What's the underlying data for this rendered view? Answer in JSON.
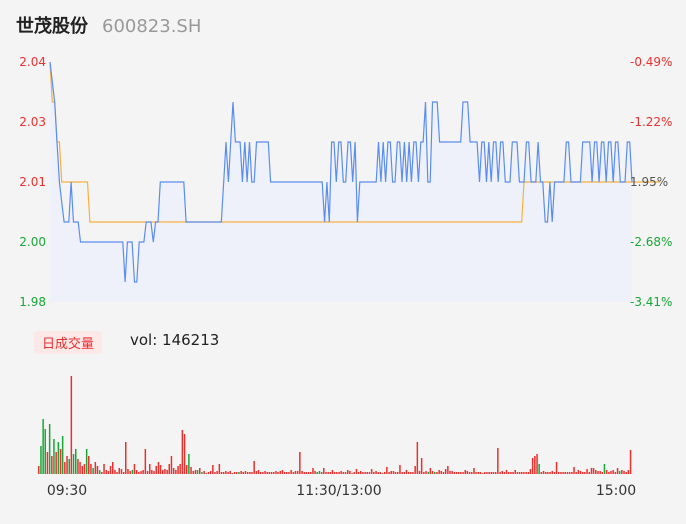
{
  "header": {
    "name": "世茂股份",
    "code": "600823.SH"
  },
  "volume_panel": {
    "badge": "日成交量",
    "vol_label": "vol: 146213"
  },
  "colors": {
    "price_line": "#5b8def",
    "avg_line": "#f5b041",
    "up": "#e8312f",
    "down": "#1aa638",
    "area_fill": "#eef1f9"
  },
  "chart_data": [
    {
      "type": "line",
      "y_left_ticks": [
        "2.04",
        "2.03",
        "2.01",
        "2.00",
        "1.98"
      ],
      "y_left_values": [
        2.04,
        2.03,
        2.01,
        2.0,
        1.98
      ],
      "y_right_ticks": [
        "-0.49%",
        "-1.22%",
        "1.95%",
        "-2.68%",
        "-3.41%"
      ],
      "ylim": [
        1.98,
        2.04
      ],
      "series": [
        {
          "key": "price",
          "values": [
            2.04,
            2.035,
            2.03,
            2.02,
            2.01,
            2.005,
            2.0,
            2.0,
            2.0,
            2.01,
            2.0,
            2.0,
            2.0,
            1.995,
            1.995,
            1.995,
            1.995,
            1.995,
            1.995,
            1.995,
            1.995,
            1.995,
            1.995,
            1.995,
            1.995,
            1.995,
            1.995,
            1.995,
            1.995,
            1.995,
            1.995,
            1.995,
            1.985,
            1.995,
            1.995,
            1.995,
            1.985,
            1.985,
            1.995,
            1.995,
            1.995,
            2.0,
            2.0,
            2.0,
            1.995,
            2.0,
            2.0,
            2.01,
            2.01,
            2.01,
            2.01,
            2.01,
            2.01,
            2.01,
            2.01,
            2.01,
            2.01,
            2.01,
            2.0,
            2.0,
            2.0,
            2.0,
            2.0,
            2.0,
            2.0,
            2.0,
            2.0,
            2.0,
            2.0,
            2.0,
            2.0,
            2.0,
            2.0,
            2.0,
            2.01,
            2.02,
            2.01,
            2.02,
            2.03,
            2.02,
            2.02,
            2.02,
            2.01,
            2.02,
            2.01,
            2.02,
            2.01,
            2.01,
            2.02,
            2.02,
            2.02,
            2.02,
            2.02,
            2.02,
            2.01,
            2.01,
            2.01,
            2.01,
            2.01,
            2.01,
            2.01,
            2.01,
            2.01,
            2.01,
            2.01,
            2.01,
            2.01,
            2.01,
            2.01,
            2.01,
            2.01,
            2.01,
            2.01,
            2.01,
            2.01,
            2.01,
            2.01,
            2.0,
            2.01,
            2.0,
            2.02,
            2.02,
            2.01,
            2.02,
            2.02,
            2.01,
            2.01,
            2.02,
            2.02,
            2.01,
            2.02,
            2.0,
            2.01,
            2.01,
            2.01,
            2.01,
            2.01,
            2.01,
            2.01,
            2.01,
            2.02,
            2.01,
            2.02,
            2.01,
            2.02,
            2.02,
            2.01,
            2.01,
            2.02,
            2.02,
            2.01,
            2.02,
            2.01,
            2.02,
            2.01,
            2.02,
            2.02,
            2.01,
            2.02,
            2.02,
            2.03,
            2.01,
            2.01,
            2.03,
            2.03,
            2.03,
            2.02,
            2.02,
            2.02,
            2.02,
            2.02,
            2.02,
            2.02,
            2.02,
            2.02,
            2.02,
            2.03,
            2.03,
            2.03,
            2.02,
            2.02,
            2.02,
            2.02,
            2.01,
            2.02,
            2.02,
            2.01,
            2.02,
            2.01,
            2.02,
            2.02,
            2.01,
            2.02,
            2.02,
            2.01,
            2.01,
            2.01,
            2.02,
            2.02,
            2.02,
            2.01,
            2.01,
            2.01,
            2.02,
            2.02,
            2.01,
            2.01,
            2.01,
            2.02,
            2.01,
            2.01,
            2.0,
            2.0,
            2.01,
            2.0,
            2.01,
            2.01,
            2.01,
            2.01,
            2.01,
            2.02,
            2.02,
            2.01,
            2.01,
            2.01,
            2.01,
            2.01,
            2.02,
            2.02,
            2.02,
            2.02,
            2.01,
            2.02,
            2.02,
            2.01,
            2.02,
            2.02,
            2.01,
            2.02,
            2.02,
            2.01,
            2.02,
            2.02,
            2.01,
            2.01,
            2.01,
            2.02,
            2.02,
            2.01
          ]
        },
        {
          "key": "average",
          "values": [
            2.04,
            2.03,
            2.03,
            2.02,
            2.02,
            2.01,
            2.01,
            2.01,
            2.01,
            2.01,
            2.01,
            2.01,
            2.01,
            2.01,
            2.01,
            2.01,
            2.01,
            2.0,
            2.0,
            2.0,
            2.0,
            2.0,
            2.0,
            2.0,
            2.0,
            2.0,
            2.0,
            2.0,
            2.0,
            2.0,
            2.0,
            2.0,
            2.0,
            2.0,
            2.0,
            2.0,
            2.0,
            2.0,
            2.0,
            2.0,
            2.0,
            2.0,
            2.0,
            2.0,
            2.0,
            2.0,
            2.0,
            2.0,
            2.0,
            2.0,
            2.0,
            2.0,
            2.0,
            2.0,
            2.0,
            2.0,
            2.0,
            2.0,
            2.0,
            2.0,
            2.0,
            2.0,
            2.0,
            2.0,
            2.0,
            2.0,
            2.0,
            2.0,
            2.0,
            2.0,
            2.0,
            2.0,
            2.0,
            2.0,
            2.0,
            2.0,
            2.0,
            2.0,
            2.0,
            2.0,
            2.0,
            2.0,
            2.0,
            2.0,
            2.0,
            2.0,
            2.0,
            2.0,
            2.0,
            2.0,
            2.0,
            2.0,
            2.0,
            2.0,
            2.0,
            2.0,
            2.0,
            2.0,
            2.0,
            2.0,
            2.0,
            2.0,
            2.0,
            2.0,
            2.0,
            2.0,
            2.0,
            2.0,
            2.0,
            2.0,
            2.0,
            2.0,
            2.0,
            2.0,
            2.0,
            2.0,
            2.0,
            2.0,
            2.0,
            2.0,
            2.0,
            2.0,
            2.0,
            2.0,
            2.0,
            2.0,
            2.0,
            2.0,
            2.0,
            2.0,
            2.0,
            2.0,
            2.0,
            2.0,
            2.0,
            2.0,
            2.0,
            2.0,
            2.0,
            2.0,
            2.0,
            2.0,
            2.0,
            2.0,
            2.0,
            2.0,
            2.0,
            2.0,
            2.0,
            2.0,
            2.0,
            2.0,
            2.0,
            2.0,
            2.0,
            2.0,
            2.0,
            2.0,
            2.0,
            2.0,
            2.0,
            2.0,
            2.0,
            2.0,
            2.0,
            2.0,
            2.0,
            2.0,
            2.0,
            2.0,
            2.0,
            2.0,
            2.0,
            2.0,
            2.0,
            2.0,
            2.0,
            2.0,
            2.0,
            2.0,
            2.0,
            2.0,
            2.0,
            2.0,
            2.0,
            2.0,
            2.0,
            2.0,
            2.0,
            2.0,
            2.0,
            2.0,
            2.0,
            2.0,
            2.0,
            2.0,
            2.0,
            2.0,
            2.0,
            2.0,
            2.0,
            2.0,
            2.01,
            2.01,
            2.01,
            2.01,
            2.01,
            2.01,
            2.01,
            2.01,
            2.01,
            2.01,
            2.01,
            2.01,
            2.01,
            2.01,
            2.01,
            2.01,
            2.01,
            2.01,
            2.01,
            2.01,
            2.01,
            2.01,
            2.01,
            2.01,
            2.01,
            2.01,
            2.01,
            2.01,
            2.01,
            2.01,
            2.01,
            2.01,
            2.01,
            2.01,
            2.01,
            2.01,
            2.01,
            2.01,
            2.01,
            2.01,
            2.01,
            2.01,
            2.01,
            2.01,
            2.01,
            2.01,
            2.01,
            2.01,
            2.01,
            2.01,
            2.01,
            2.01,
            2.01,
            2.01,
            2.01,
            2.01,
            2.01,
            2.01,
            2.01
          ]
        }
      ]
    },
    {
      "type": "bar",
      "x_ticks": [
        "09:30",
        "11:30/13:00",
        "15:00"
      ],
      "volumes": [
        8,
        28,
        55,
        45,
        22,
        50,
        18,
        35,
        22,
        32,
        25,
        38,
        12,
        18,
        15,
        98,
        20,
        25,
        15,
        12,
        8,
        10,
        25,
        18,
        10,
        6,
        12,
        8,
        4,
        2,
        10,
        4,
        3,
        8,
        12,
        4,
        2,
        6,
        5,
        2,
        32,
        5,
        3,
        4,
        10,
        4,
        2,
        3,
        4,
        25,
        3,
        10,
        4,
        3,
        8,
        12,
        9,
        4,
        5,
        4,
        10,
        18,
        6,
        4,
        8,
        10,
        44,
        40,
        9,
        20,
        7,
        3,
        4,
        4,
        6,
        2,
        3,
        1,
        2,
        3,
        9,
        2,
        3,
        10,
        2,
        2,
        3,
        2,
        3,
        1,
        2,
        2,
        2,
        3,
        2,
        3,
        2,
        2,
        2,
        13,
        3,
        4,
        2,
        2,
        3,
        2,
        2,
        2,
        2,
        3,
        2,
        3,
        4,
        2,
        2,
        2,
        4,
        2,
        3,
        3,
        22,
        3,
        2,
        2,
        2,
        2,
        6,
        3,
        2,
        3,
        2,
        6,
        2,
        2,
        2,
        4,
        2,
        2,
        2,
        3,
        2,
        2,
        4,
        3,
        1,
        2,
        5,
        2,
        3,
        2,
        2,
        2,
        2,
        5,
        2,
        3,
        2,
        2,
        1,
        2,
        7,
        2,
        3,
        3,
        2,
        2,
        9,
        2,
        2,
        4,
        2,
        2,
        2,
        8,
        32,
        3,
        16,
        2,
        3,
        2,
        6,
        3,
        2,
        2,
        4,
        3,
        2,
        5,
        8,
        3,
        3,
        2,
        2,
        2,
        2,
        2,
        4,
        3,
        2,
        2,
        6,
        2,
        2,
        2,
        1,
        2,
        2,
        2,
        2,
        2,
        2,
        26,
        2,
        3,
        2,
        4,
        2,
        2,
        2,
        4,
        2,
        2,
        2,
        2,
        2,
        2,
        5,
        16,
        18,
        20,
        10,
        2,
        3,
        2,
        2,
        2,
        3,
        2,
        12,
        2,
        2,
        2,
        2,
        2,
        2,
        2,
        7,
        2,
        4,
        3,
        2,
        2,
        5,
        2,
        6,
        6,
        4,
        3,
        3,
        2,
        10,
        4,
        2,
        3,
        4,
        2,
        6,
        3,
        4,
        3,
        2,
        4,
        24
      ],
      "directions": "rgggrgrgrgrgrrgrggrrrrgrrgrrgrrrrrrrrrrrrrrgrrrrrrrrrrrrrrrrrrrrrrrrrgrrrgrgrrrrrrrrrrrrrrrrgrrrrrrrrrrrrrrrrrrrrrrrrrrrrrrrrrrrggrrrrrrrrrrrrrrrrrrrrrrrrrrrrrrrrrrrrrrrrrrrrrrrrrgrrgrrrrrrrrrrrrrrrrrrrrrrrrrrrrrrrrrrrrrrrrrrrrrrrgrrrrrrrrrrrrrrrrrrrrrrrrrrrrrgrrrrrrgrrrrrrrrrgrrgrrrrrrrrrrr"
    }
  ]
}
